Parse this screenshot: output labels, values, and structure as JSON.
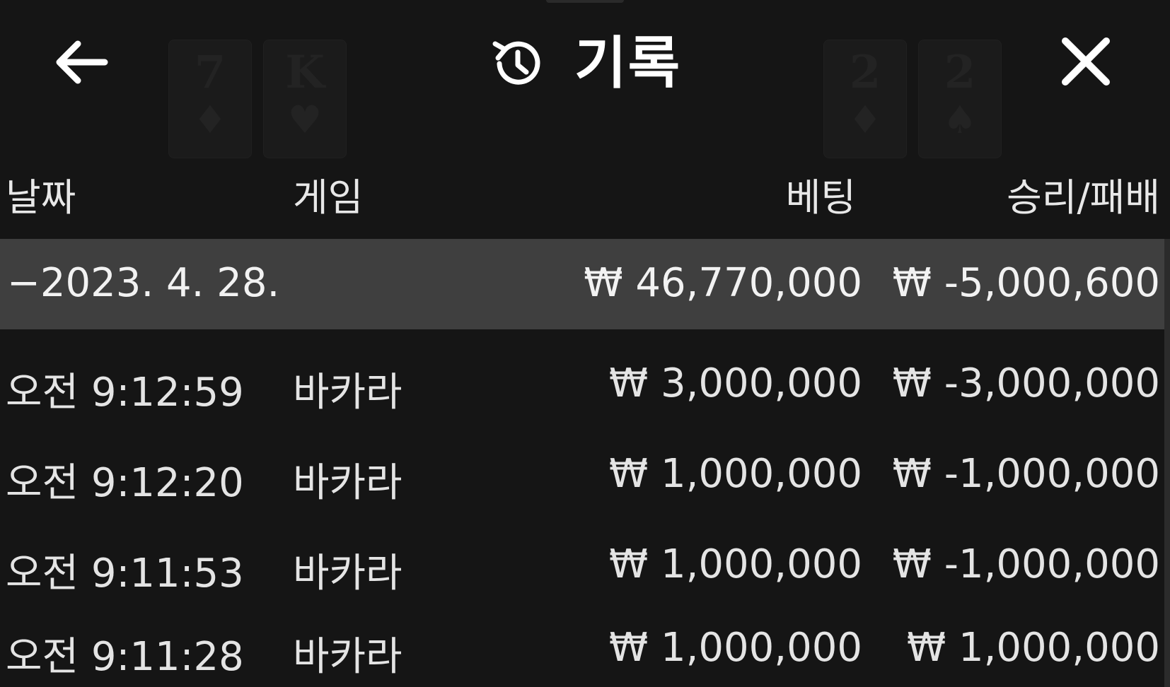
{
  "header": {
    "title": "기록",
    "back_icon": "arrow-left-icon",
    "history_icon": "history-clock-icon",
    "close_icon": "close-icon"
  },
  "columns": {
    "date": "날짜",
    "game": "게임",
    "bet": "베팅",
    "result": "승리/패배"
  },
  "summary": {
    "date": "−2023. 4. 28.",
    "bet": "₩ 46,770,000",
    "result": "₩ -5,000,600"
  },
  "rows": [
    {
      "time": "오전 9:12:59",
      "game": "바카라",
      "bet": "₩ 3,000,000",
      "result": "₩ -3,000,000"
    },
    {
      "time": "오전 9:12:20",
      "game": "바카라",
      "bet": "₩ 1,000,000",
      "result": "₩ -1,000,000"
    },
    {
      "time": "오전 9:11:53",
      "game": "바카라",
      "bet": "₩ 1,000,000",
      "result": "₩ -1,000,000"
    },
    {
      "time": "오전 9:11:28",
      "game": "바카라",
      "bet": "₩ 1,000,000",
      "result": "₩ 1,000,000"
    }
  ],
  "colors": {
    "background": "#151515",
    "summary_row": "#3f3f3f",
    "text": "#e6e6e6"
  }
}
